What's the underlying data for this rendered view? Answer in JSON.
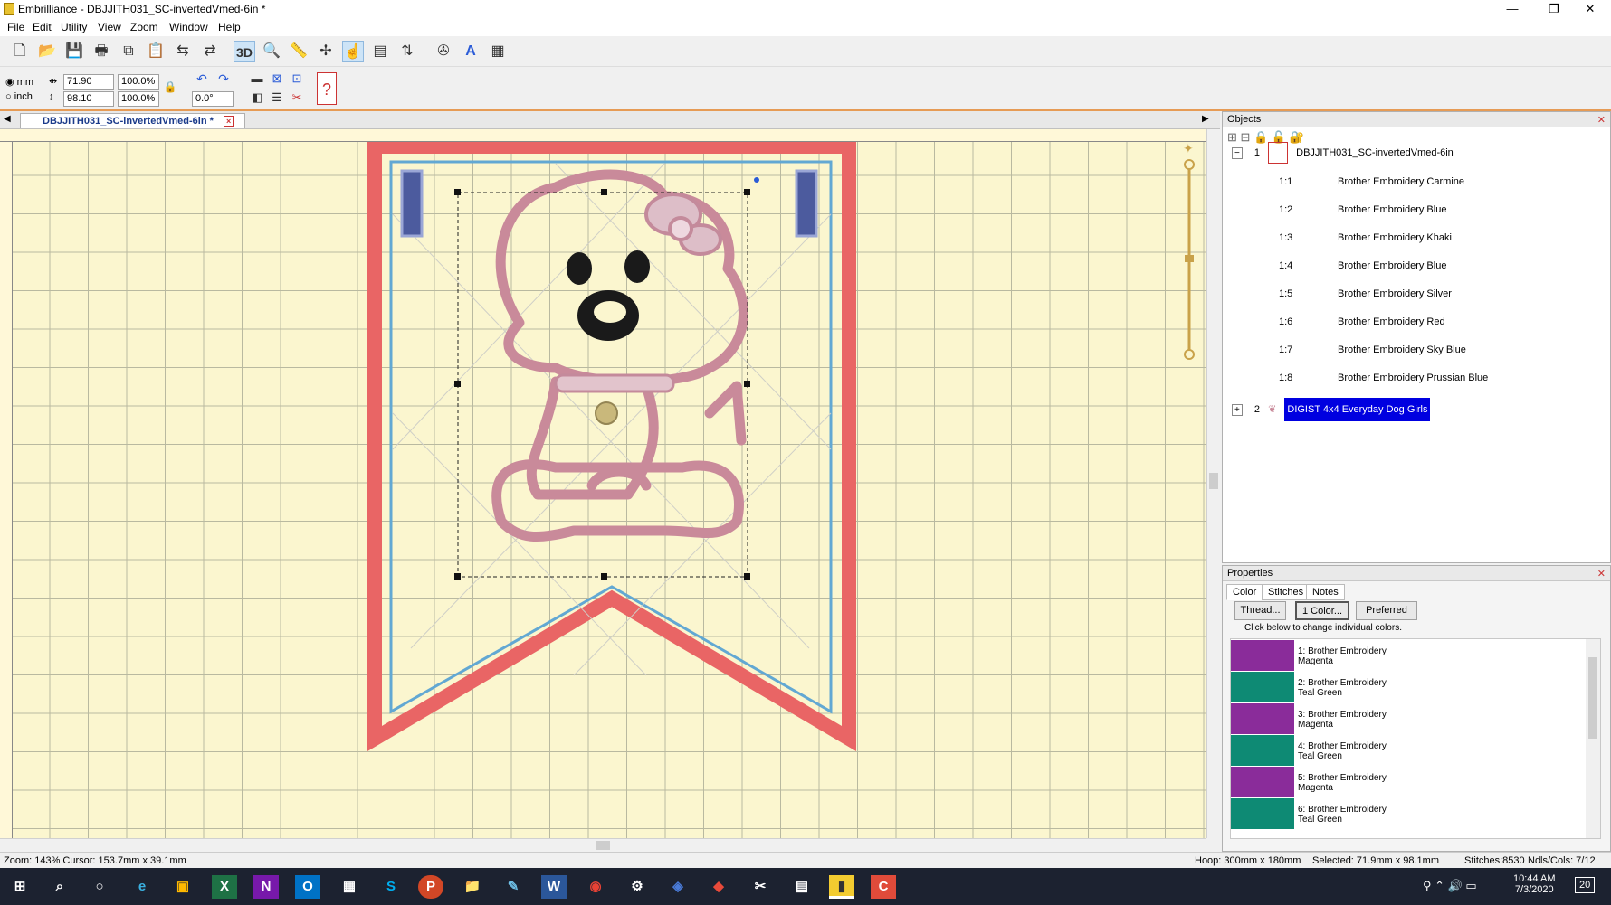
{
  "window": {
    "app": "Embrilliance",
    "title": "Embrilliance - DBJJITH031_SC-invertedVmed-6in *"
  },
  "menu": [
    "File",
    "Edit",
    "Utility",
    "View",
    "Zoom",
    "Window",
    "Help"
  ],
  "toolbar2": {
    "unit_mm": "mm",
    "unit_inch": "inch",
    "width": "71.90",
    "height": "98.10",
    "width_pct": "100.0%",
    "height_pct": "100.0%",
    "rotation": "0.0°"
  },
  "doc_tab": "DBJJITH031_SC-invertedVmed-6in *",
  "objects": {
    "header": "Objects",
    "group1": {
      "num": "1",
      "label": "DBJJITH031_SC-invertedVmed-6in"
    },
    "items": [
      {
        "num": "1:1",
        "label": "Brother Embroidery Carmine"
      },
      {
        "num": "1:2",
        "label": "Brother Embroidery Blue"
      },
      {
        "num": "1:3",
        "label": "Brother Embroidery Khaki"
      },
      {
        "num": "1:4",
        "label": "Brother Embroidery Blue"
      },
      {
        "num": "1:5",
        "label": "Brother Embroidery Silver"
      },
      {
        "num": "1:6",
        "label": "Brother Embroidery Red"
      },
      {
        "num": "1:7",
        "label": "Brother Embroidery Sky Blue"
      },
      {
        "num": "1:8",
        "label": "Brother Embroidery Prussian Blue"
      }
    ],
    "group2": {
      "num": "2",
      "label": "DIGIST 4x4 Everyday Dog Girls"
    }
  },
  "properties": {
    "header": "Properties",
    "tabs": [
      "Color",
      "Stitches",
      "Notes"
    ],
    "buttons": [
      "Thread...",
      "1 Color...",
      "Preferred"
    ],
    "hint": "Click below to change individual colors.",
    "colors": [
      {
        "label1": "1: Brother Embroidery",
        "label2": "Magenta",
        "hex": "#8a2c9a"
      },
      {
        "label1": "2: Brother Embroidery",
        "label2": "Teal Green",
        "hex": "#0e8a74"
      },
      {
        "label1": "3: Brother Embroidery",
        "label2": "Magenta",
        "hex": "#8a2c9a"
      },
      {
        "label1": "4: Brother Embroidery",
        "label2": "Teal Green",
        "hex": "#0e8a74"
      },
      {
        "label1": "5: Brother Embroidery",
        "label2": "Magenta",
        "hex": "#8a2c9a"
      },
      {
        "label1": "6: Brother Embroidery",
        "label2": "Teal Green",
        "hex": "#0e8a74"
      }
    ]
  },
  "status": {
    "zoom": "Zoom: 143%  Cursor: 153.7mm x 39.1mm",
    "hoop": "Hoop: 300mm x 180mm",
    "selected": "Selected: 71.9mm x 98.1mm",
    "stitches": "Stitches:8530",
    "ndls": "Ndls/Cols: 7/12"
  },
  "taskbar": {
    "time": "10:44 AM",
    "date": "7/3/2020",
    "notif": "20"
  }
}
